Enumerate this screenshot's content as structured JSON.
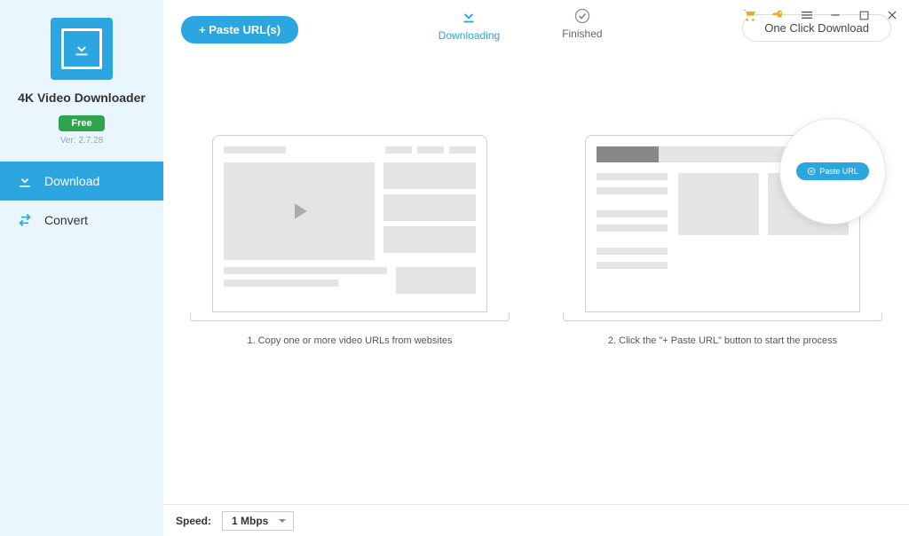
{
  "app": {
    "title": "4K Video Downloader",
    "badge": "Free",
    "version": "Ver: 2.7.28"
  },
  "nav": {
    "download": "Download",
    "convert": "Convert"
  },
  "toolbar": {
    "paste_btn": "+ Paste URL(s)",
    "one_click": "One Click Download"
  },
  "tabs": {
    "downloading": "Downloading",
    "finished": "Finished"
  },
  "captions": {
    "step1": "1. Copy one or more video URLs from websites",
    "step2": "2. Click the \"+ Paste URL\" button to start the process"
  },
  "magnify": {
    "btn": "Paste URL"
  },
  "footer": {
    "speed_label": "Speed:",
    "speed_value": "1 Mbps"
  }
}
